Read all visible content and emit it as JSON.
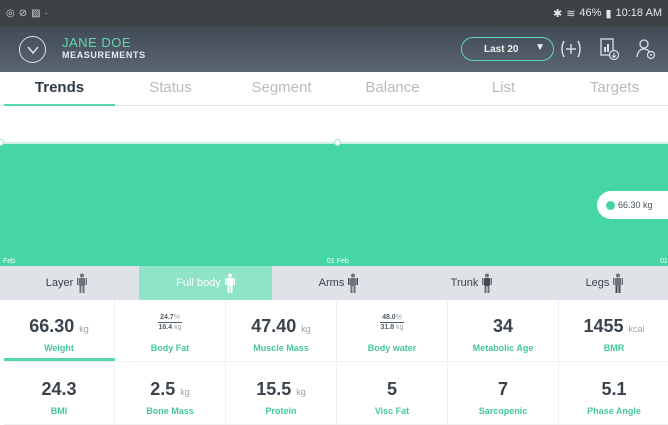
{
  "status_bar": {
    "left_icons": [
      "system-icon",
      "link-icon",
      "image-icon"
    ],
    "right_text": "46% ",
    "time": "10:18 AM"
  },
  "header": {
    "user_name": "JANE DOE",
    "subtitle": "MEASUREMENTS",
    "range_label": "Last 20",
    "accent_color": "#5fd6b0"
  },
  "tabs": [
    {
      "label": "Trends",
      "active": true
    },
    {
      "label": "Status",
      "active": false
    },
    {
      "label": "Segment",
      "active": false
    },
    {
      "label": "Balance",
      "active": false
    },
    {
      "label": "List",
      "active": false
    },
    {
      "label": "Targets",
      "active": false
    }
  ],
  "chart": {
    "left_date": "Feb",
    "mid_date": "01 Feb",
    "right_date": "01",
    "tooltip_value": "66.30 kg"
  },
  "chart_data": {
    "type": "area",
    "x": [
      "Feb",
      "01 Feb",
      "01"
    ],
    "values": [
      66.3,
      66.3,
      66.3
    ],
    "unit": "kg",
    "color": "#46d5a6"
  },
  "segments": [
    {
      "label": "Layer",
      "active": false
    },
    {
      "label": "Full body",
      "active": true
    },
    {
      "label": "Arms",
      "active": false
    },
    {
      "label": "Trunk",
      "active": false
    },
    {
      "label": "Legs",
      "active": false
    }
  ],
  "metrics_row1": [
    {
      "value": "66.30",
      "unit": "kg",
      "label": "Weight",
      "selected": true
    },
    {
      "frac_top": "24.7",
      "frac_top_unit": "%",
      "frac_bottom": "16.4",
      "frac_bottom_unit": "kg",
      "label": "Body Fat"
    },
    {
      "value": "47.40",
      "unit": "kg",
      "label": "Muscle Mass"
    },
    {
      "frac_top": "48.0",
      "frac_top_unit": "%",
      "frac_bottom": "31.8",
      "frac_bottom_unit": "kg",
      "label": "Body water"
    },
    {
      "value": "34",
      "unit": "",
      "label": "Metabolic Age"
    },
    {
      "value": "1455",
      "unit": "kcal",
      "label": "BMR"
    }
  ],
  "metrics_row2": [
    {
      "value": "24.3",
      "unit": "",
      "label": "BMI"
    },
    {
      "value": "2.5",
      "unit": "kg",
      "label": "Bone Mass"
    },
    {
      "value": "15.5",
      "unit": "kg",
      "label": "Protein"
    },
    {
      "value": "5",
      "unit": "",
      "label": "Visc Fat"
    },
    {
      "value": "7",
      "unit": "",
      "label": "Sarcopenic"
    },
    {
      "value": "5.1",
      "unit": "",
      "label": "Phase Angle"
    }
  ]
}
